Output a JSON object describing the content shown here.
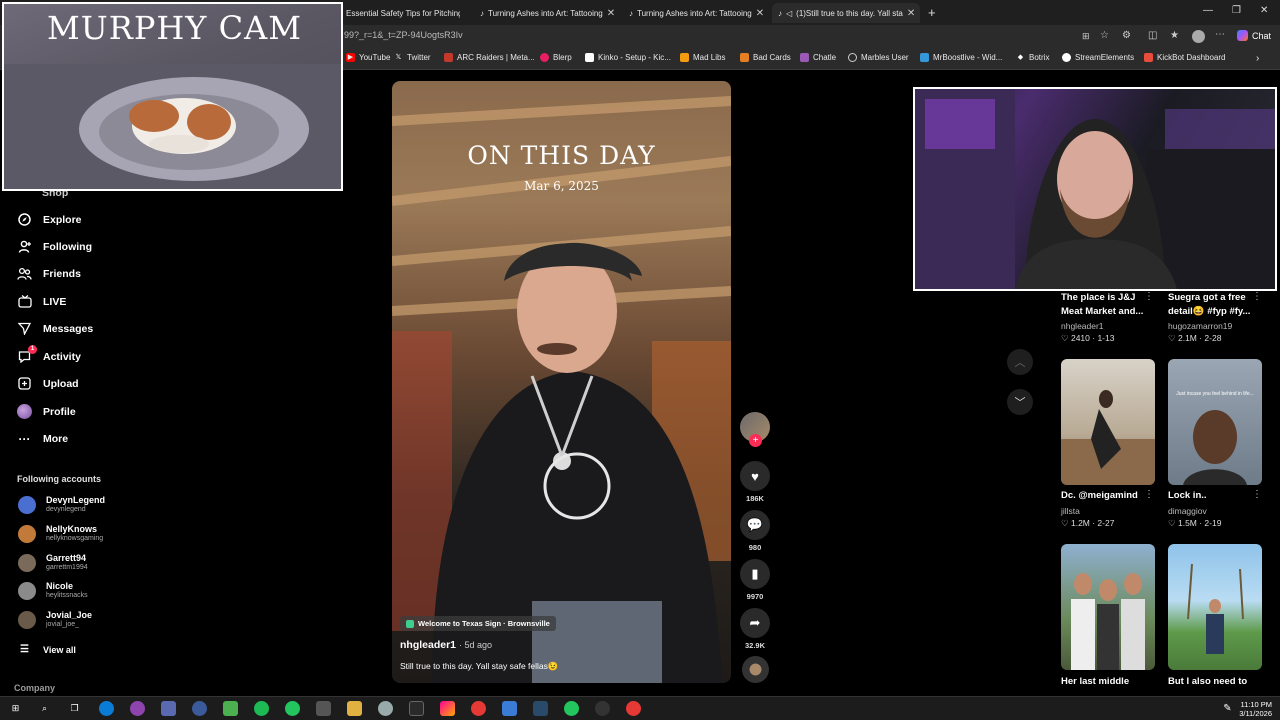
{
  "browser": {
    "tabs": [
      {
        "label": "Essential Safety Tips for Pitching a",
        "active": false
      },
      {
        "label": "Turning Ashes into Art: Tattooing",
        "active": false
      },
      {
        "label": "Turning Ashes into Art: Tattooing",
        "active": false
      },
      {
        "label": "(1)Still true to this day. Yall sta",
        "active": true
      }
    ],
    "url": "99?_r=1&_t=ZP-94UogtsR3Iv",
    "chat_label": "Chat",
    "bookmarks": [
      "YouTube",
      "Twitter",
      "ARC Raiders | Meta...",
      "Blerp",
      "Kinko - Setup - Kic...",
      "Mad Libs",
      "Bad Cards",
      "Chatle",
      "Marbles User",
      "MrBoostlive - Wid...",
      "Botrix",
      "StreamElements",
      "KickBot Dashboard"
    ]
  },
  "overlay": {
    "cam_title": "MURPHY CAM"
  },
  "sidebar": {
    "partial_item": "Shop",
    "items": [
      {
        "label": "Explore",
        "icon": "compass-icon"
      },
      {
        "label": "Following",
        "icon": "person-plus-icon"
      },
      {
        "label": "Friends",
        "icon": "friends-icon"
      },
      {
        "label": "LIVE",
        "icon": "live-icon"
      },
      {
        "label": "Messages",
        "icon": "paper-plane-icon"
      },
      {
        "label": "Activity",
        "icon": "activity-icon",
        "badge": "1"
      },
      {
        "label": "Upload",
        "icon": "upload-icon"
      },
      {
        "label": "Profile",
        "icon": "profile-avatar"
      },
      {
        "label": "More",
        "icon": "more-dots-icon"
      }
    ],
    "following_heading": "Following accounts",
    "accounts": [
      {
        "name": "DevynLegend",
        "handle": "devynlegend",
        "color": "#4a6fd1"
      },
      {
        "name": "NellyKnows",
        "handle": "nellyknowsgaming",
        "color": "#c27a3a"
      },
      {
        "name": "Garrett94",
        "handle": "garrettm1994",
        "color": "#7a6a5a"
      },
      {
        "name": "Nicole",
        "handle": "heylitssnacks",
        "color": "#8a8a8a"
      },
      {
        "name": "Jovial_Joe",
        "handle": "jovial_joe_",
        "color": "#6a5a4a"
      }
    ],
    "view_all": "View all",
    "company": "Company"
  },
  "video": {
    "overlay_title": "ON THIS DAY",
    "overlay_date": "Mar 6, 2025",
    "location": "Welcome to Texas Sign · Brownsville",
    "author": "nhgleader1",
    "age": "· 5d ago",
    "caption": "Still true to this day. Yall stay safe fellas😉",
    "likes": "186K",
    "comments": "980",
    "saves": "9970",
    "shares": "32.9K"
  },
  "grid": [
    {
      "title": "The place is J&J Meat Market and...",
      "user": "nhgleader1",
      "stats": "♡ 2410 · 1-13"
    },
    {
      "title": "Suegra got a free detail😆 #fyp #fy...",
      "user": "hugozamarron19",
      "stats": "♡ 2.1M · 2-28"
    },
    {
      "title": "Dc. @meigamind",
      "user": "jillsta",
      "stats": "♡ 1.2M · 2-27"
    },
    {
      "title": "Lock in..",
      "user": "dimaggiov",
      "stats": "♡ 1.5M · 2-19",
      "thumb_text": "Just incase you feel behind in life..."
    },
    {
      "title": "Her last middle",
      "user": "",
      "stats": ""
    },
    {
      "title": "But I also need to",
      "user": "",
      "stats": ""
    }
  ],
  "taskbar": {
    "time": "11:10 PM",
    "date": "3/11/2026"
  }
}
